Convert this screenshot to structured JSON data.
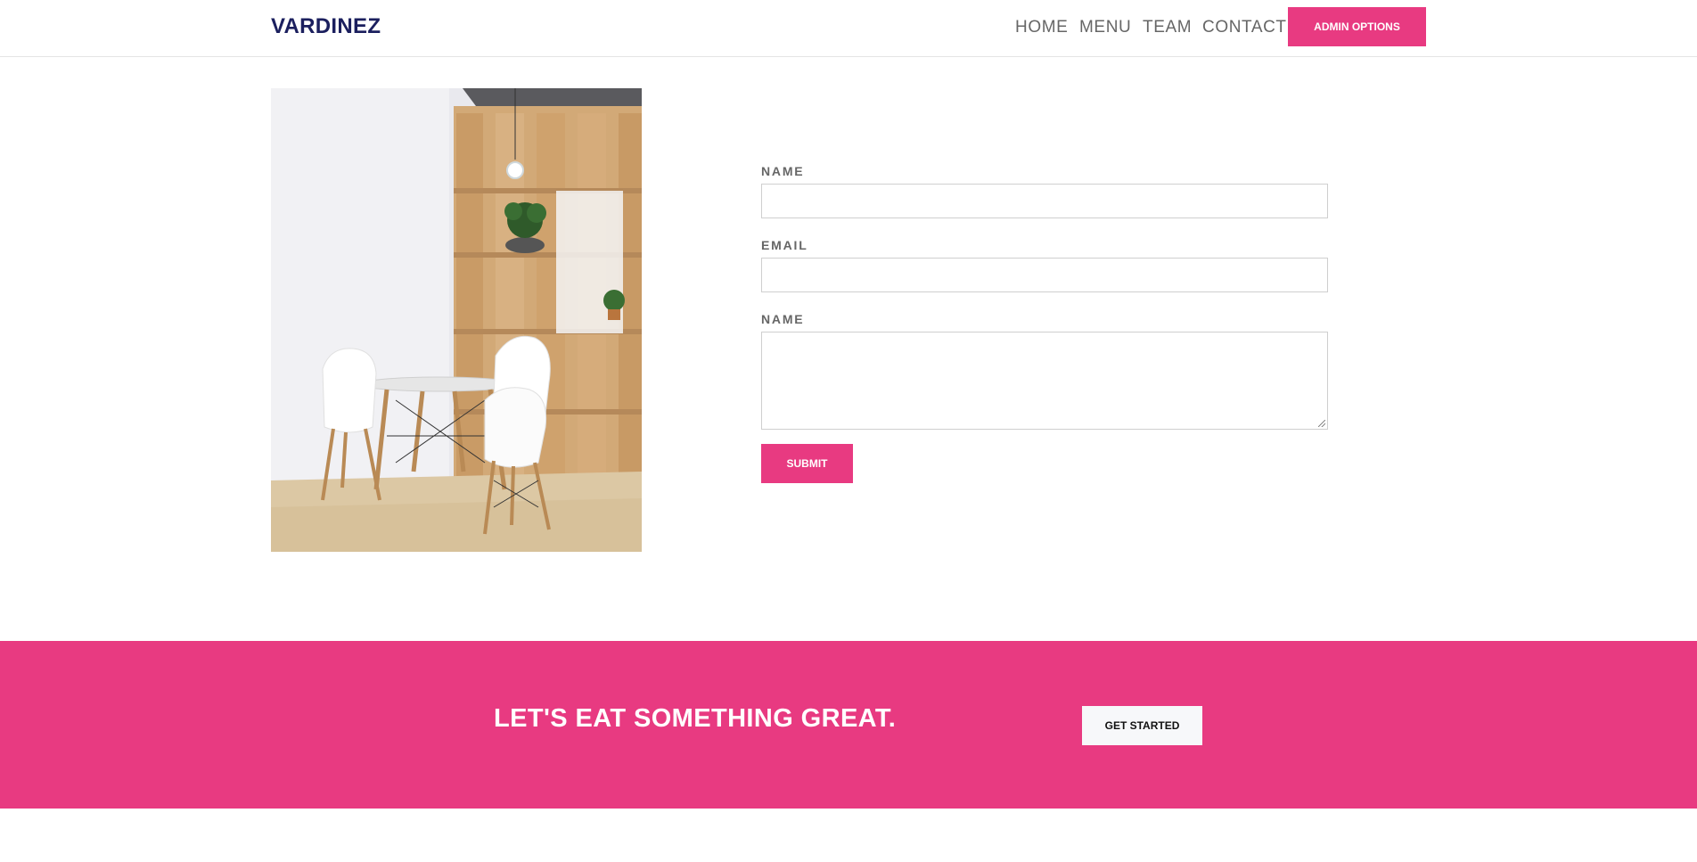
{
  "header": {
    "brand": "VARDINEZ",
    "nav": {
      "home": "HOME",
      "menu": "MENU",
      "team": "TEAM",
      "contact": "CONTACT"
    },
    "admin_button": "ADMIN OPTIONS"
  },
  "photo": {
    "icon": "interior-photo"
  },
  "form": {
    "name_label": "NAME",
    "name_value": "",
    "email_label": "EMAIL",
    "email_value": "",
    "message_label": "NAME",
    "message_value": "",
    "submit_label": "SUBMIT"
  },
  "cta": {
    "text": "LET'S EAT SOMETHING GREAT.",
    "button": "GET STARTED"
  },
  "colors": {
    "accent": "#e83a81",
    "brand": "#1b1f5e",
    "nav_text": "#666666"
  }
}
